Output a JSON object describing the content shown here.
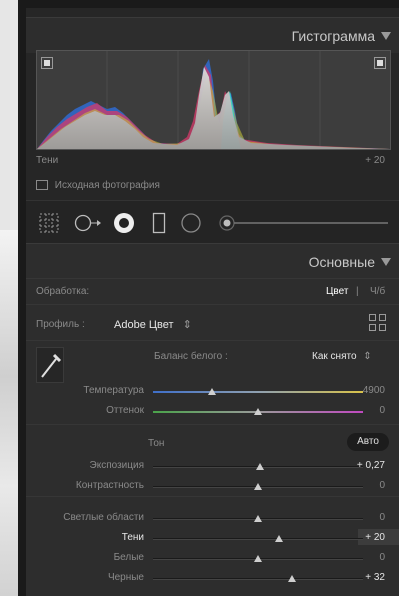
{
  "histogram": {
    "title": "Гистограмма",
    "info_label": "Тени",
    "info_value": "+ 20",
    "original_photo_label": "Исходная фотография"
  },
  "basic": {
    "title": "Основные",
    "treatment_label": "Обработка:",
    "treatment_color": "Цвет",
    "treatment_separator": "|",
    "treatment_bw": "Ч/б",
    "profile_label": "Профиль :",
    "profile_value": "Adobe Цвет",
    "wb_label": "Баланс белого :",
    "wb_value": "Как снято",
    "tone_label": "Тон",
    "auto_label": "Авто",
    "sliders": [
      {
        "label": "Температура",
        "value": "4900",
        "pos": 0.28
      },
      {
        "label": "Оттенок",
        "value": "0",
        "pos": 0.5
      },
      {
        "label": "Экспозиция",
        "value": "+ 0,27",
        "pos": 0.51
      },
      {
        "label": "Контрастность",
        "value": "0",
        "pos": 0.5
      },
      {
        "label": "Светлые области",
        "value": "0",
        "pos": 0.5
      },
      {
        "label": "Тени",
        "value": "+ 20",
        "pos": 0.6
      },
      {
        "label": "Белые",
        "value": "0",
        "pos": 0.5
      },
      {
        "label": "Черные",
        "value": "+ 32",
        "pos": 0.66
      }
    ]
  },
  "colors": {
    "panel_bg": "#262626",
    "header_bg": "#2d2d2d",
    "text": "#bdbdbd"
  }
}
